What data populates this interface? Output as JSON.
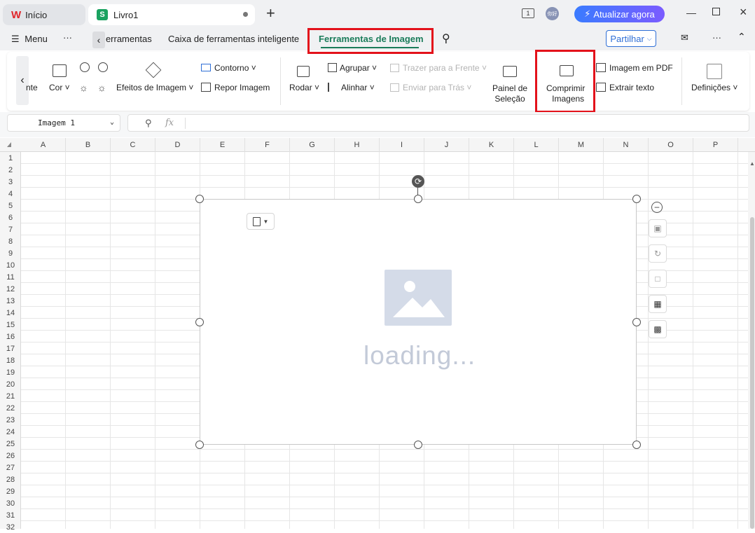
{
  "titlebar": {
    "home_tab": "Início",
    "doc_tab": "Livro1",
    "screen_badge": "1",
    "avatar": "你好",
    "upgrade": "Atualizar agora"
  },
  "menu": {
    "menu_label": "Menu",
    "tab_prev": "Ferramentas",
    "tab_toolbox": "Caixa de ferramentas inteligente",
    "tab_image": "Ferramentas de Imagem",
    "share": "Partilhar"
  },
  "ribbon": {
    "partial_left": "nte",
    "cor": "Cor",
    "efeitos": "Efeitos de Imagem",
    "contorno": "Contorno",
    "repor": "Repor Imagem",
    "rodar": "Rodar",
    "agrupar": "Agrupar",
    "alinhar": "Alinhar",
    "trazer": "Trazer para a Frente",
    "enviar": "Enviar para Trás",
    "painel_1": "Painel de",
    "painel_2": "Seleção",
    "comprimir_1": "Comprimir",
    "comprimir_2": "Imagens",
    "imagem_pdf": "Imagem em PDF",
    "extrair": "Extrair texto",
    "definicoes": "Definições"
  },
  "formula": {
    "name_box": "Imagem 1",
    "fx": "fx",
    "value": ""
  },
  "grid": {
    "columns": [
      "A",
      "B",
      "C",
      "D",
      "E",
      "F",
      "G",
      "H",
      "I",
      "J",
      "K",
      "L",
      "M",
      "N",
      "O",
      "P"
    ],
    "rows": [
      "1",
      "2",
      "3",
      "4",
      "5",
      "6",
      "7",
      "8",
      "9",
      "10",
      "11",
      "12",
      "13",
      "14",
      "15",
      "16",
      "17",
      "18",
      "19",
      "20",
      "21",
      "22",
      "23",
      "24",
      "25",
      "26",
      "27",
      "28",
      "29",
      "30",
      "31",
      "32"
    ]
  },
  "image": {
    "status": "loading..."
  }
}
